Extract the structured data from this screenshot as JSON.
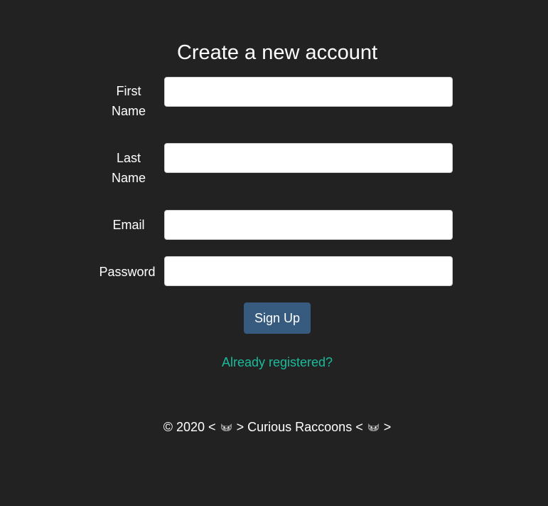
{
  "page": {
    "title": "Create a new account"
  },
  "form": {
    "fields": [
      {
        "label_line1": "First",
        "label_line2": "Name",
        "value": "",
        "placeholder": ""
      },
      {
        "label_line1": "Last",
        "label_line2": "Name",
        "value": "",
        "placeholder": ""
      },
      {
        "label": "Email",
        "value": "",
        "placeholder": ""
      },
      {
        "label": "Password",
        "value": "",
        "placeholder": ""
      }
    ],
    "submit_label": "Sign Up",
    "login_link": "Already registered?"
  },
  "footer": {
    "prefix": "© 2020 <",
    "middle": "> Curious Raccoons <",
    "suffix": ">",
    "icon": "raccoon-icon"
  },
  "colors": {
    "background": "#222222",
    "text": "#ffffff",
    "button": "#375a7f",
    "link": "#18bc9c"
  }
}
